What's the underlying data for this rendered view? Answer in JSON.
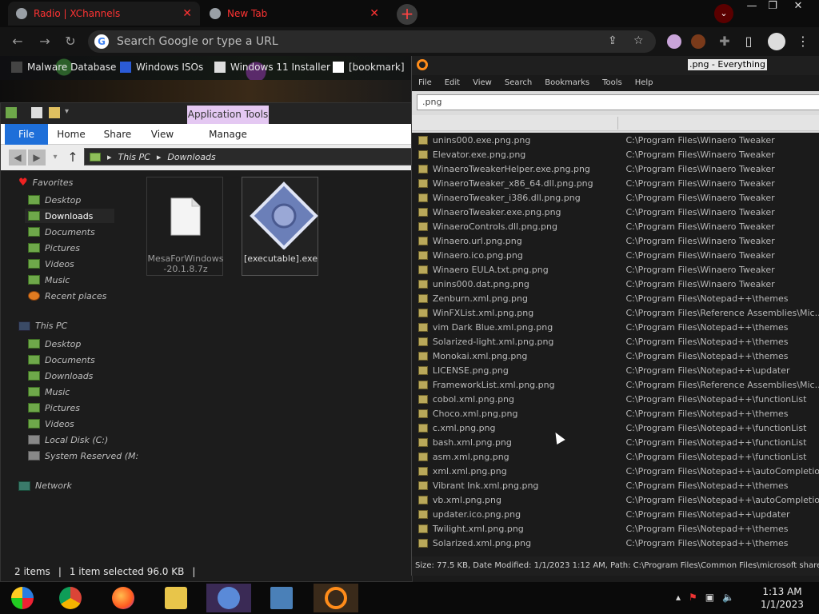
{
  "browser": {
    "tabs": [
      {
        "label": "Radio | XChannels",
        "close": "✕"
      },
      {
        "label": "New Tab",
        "close": "✕"
      }
    ],
    "new_tab": "+",
    "omnibox_placeholder": "Search Google or type a URL",
    "window_controls": {
      "minimize": "—",
      "restore": "❐",
      "close": "✕"
    },
    "bookmarks": [
      {
        "label": "Malware Database"
      },
      {
        "label": "Windows ISOs"
      },
      {
        "label": "Windows 11 Installer"
      },
      {
        "label": "[bookmark]"
      }
    ]
  },
  "explorer": {
    "app_tools": "Application Tools",
    "ribbon_tabs": [
      "File",
      "Home",
      "Share",
      "View",
      "Manage"
    ],
    "breadcrumb": [
      "This PC",
      "Downloads"
    ],
    "nav": {
      "favorites_header": "Favorites",
      "favorites": [
        "Desktop",
        "Downloads",
        "Documents",
        "Pictures",
        "Videos",
        "Music",
        "Recent places"
      ],
      "thispc_header": "This PC",
      "thispc": [
        "Desktop",
        "Documents",
        "Downloads",
        "Music",
        "Pictures",
        "Videos",
        "Local Disk (C:)",
        "System Reserved (M:"
      ],
      "network": "Network"
    },
    "files": [
      {
        "name": "MesaForWindows-20.1.8.7z",
        "icon": "blank-document-icon"
      },
      {
        "name": "[executable].exe",
        "icon": "installer-package-icon"
      }
    ],
    "status": {
      "count": "2 items",
      "selected": "1 item selected  96.0 KB"
    }
  },
  "everything": {
    "title": ".png - Everything",
    "menu": [
      "File",
      "Edit",
      "View",
      "Search",
      "Bookmarks",
      "Tools",
      "Help"
    ],
    "search_value": ".png",
    "rows": [
      {
        "name": "unins000.exe.png.png",
        "path": "C:\\Program Files\\Winaero Tweaker"
      },
      {
        "name": "Elevator.exe.png.png",
        "path": "C:\\Program Files\\Winaero Tweaker"
      },
      {
        "name": "WinaeroTweakerHelper.exe.png.png",
        "path": "C:\\Program Files\\Winaero Tweaker"
      },
      {
        "name": "WinaeroTweaker_x86_64.dll.png.png",
        "path": "C:\\Program Files\\Winaero Tweaker"
      },
      {
        "name": "WinaeroTweaker_i386.dll.png.png",
        "path": "C:\\Program Files\\Winaero Tweaker"
      },
      {
        "name": "WinaeroTweaker.exe.png.png",
        "path": "C:\\Program Files\\Winaero Tweaker"
      },
      {
        "name": "WinaeroControls.dll.png.png",
        "path": "C:\\Program Files\\Winaero Tweaker"
      },
      {
        "name": "Winaero.url.png.png",
        "path": "C:\\Program Files\\Winaero Tweaker"
      },
      {
        "name": "Winaero.ico.png.png",
        "path": "C:\\Program Files\\Winaero Tweaker"
      },
      {
        "name": "Winaero EULA.txt.png.png",
        "path": "C:\\Program Files\\Winaero Tweaker"
      },
      {
        "name": "unins000.dat.png.png",
        "path": "C:\\Program Files\\Winaero Tweaker"
      },
      {
        "name": "Zenburn.xml.png.png",
        "path": "C:\\Program Files\\Notepad++\\themes"
      },
      {
        "name": "WinFXList.xml.png.png",
        "path": "C:\\Program Files\\Reference Assemblies\\Mic..."
      },
      {
        "name": "vim Dark Blue.xml.png.png",
        "path": "C:\\Program Files\\Notepad++\\themes"
      },
      {
        "name": "Solarized-light.xml.png.png",
        "path": "C:\\Program Files\\Notepad++\\themes"
      },
      {
        "name": "Monokai.xml.png.png",
        "path": "C:\\Program Files\\Notepad++\\themes"
      },
      {
        "name": "LICENSE.png.png",
        "path": "C:\\Program Files\\Notepad++\\updater"
      },
      {
        "name": "FrameworkList.xml.png.png",
        "path": "C:\\Program Files\\Reference Assemblies\\Mic..."
      },
      {
        "name": "cobol.xml.png.png",
        "path": "C:\\Program Files\\Notepad++\\functionList"
      },
      {
        "name": "Choco.xml.png.png",
        "path": "C:\\Program Files\\Notepad++\\themes"
      },
      {
        "name": "c.xml.png.png",
        "path": "C:\\Program Files\\Notepad++\\functionList"
      },
      {
        "name": "bash.xml.png.png",
        "path": "C:\\Program Files\\Notepad++\\functionList"
      },
      {
        "name": "asm.xml.png.png",
        "path": "C:\\Program Files\\Notepad++\\functionList"
      },
      {
        "name": "xml.xml.png.png",
        "path": "C:\\Program Files\\Notepad++\\autoCompletion"
      },
      {
        "name": "Vibrant Ink.xml.png.png",
        "path": "C:\\Program Files\\Notepad++\\themes"
      },
      {
        "name": "vb.xml.png.png",
        "path": "C:\\Program Files\\Notepad++\\autoCompletion"
      },
      {
        "name": "updater.ico.png.png",
        "path": "C:\\Program Files\\Notepad++\\updater"
      },
      {
        "name": "Twilight.xml.png.png",
        "path": "C:\\Program Files\\Notepad++\\themes"
      },
      {
        "name": "Solarized.xml.png.png",
        "path": "C:\\Program Files\\Notepad++\\themes"
      }
    ],
    "status": "Size: 77.5 KB, Date Modified: 1/1/2023 1:12 AM, Path: C:\\Program Files\\Common Files\\microsoft shared\\"
  },
  "taskbar": {
    "apps": [
      "start-button",
      "chrome-icon",
      "firefox-icon",
      "file-explorer-icon",
      "people-icon",
      "photos-icon",
      "everything-icon"
    ],
    "time": "1:13 AM",
    "date": "1/1/2023"
  },
  "colors": {
    "tab_text": "#ff3333",
    "accent_blue": "#1e6fd9",
    "app_tools": "#e4c8f2",
    "everything_orange": "#ff8c1a"
  }
}
